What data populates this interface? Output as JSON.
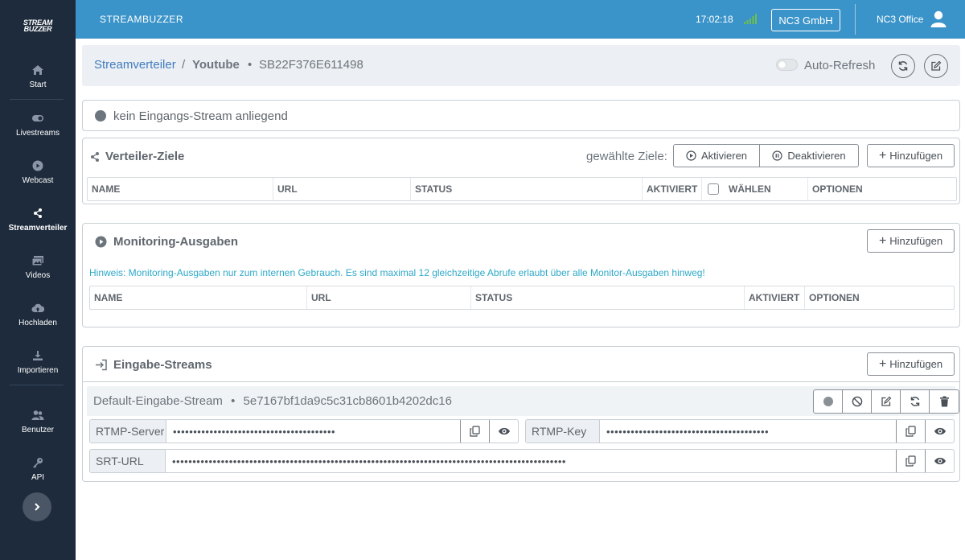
{
  "colors": {
    "sidebar_bg": "#1e2b3c",
    "topbar_bg": "#3b94c9",
    "link": "#3f7cbf",
    "hint": "#2ea9c7",
    "signal": "#6cc04a"
  },
  "sidebar": {
    "logo_line1": "STREAM",
    "logo_line2": "BUZZER",
    "items": [
      {
        "label": "Start",
        "icon": "home-icon"
      },
      {
        "label": "Livestreams",
        "icon": "toggle-icon"
      },
      {
        "label": "Webcast",
        "icon": "play-circle-icon"
      },
      {
        "label": "Streamverteiler",
        "icon": "share-icon",
        "active": true
      },
      {
        "label": "Videos",
        "icon": "images-icon"
      },
      {
        "label": "Hochladen",
        "icon": "cloud-upload-icon"
      },
      {
        "label": "Importieren",
        "icon": "download-icon"
      },
      {
        "label": "Benutzer",
        "icon": "users-icon"
      },
      {
        "label": "API",
        "icon": "key-icon"
      }
    ]
  },
  "topbar": {
    "brand": "STREAMBUZZER",
    "time": "17:02:18",
    "company": "NC3 GmbH",
    "user": "NC3 Office"
  },
  "breadcrumb": {
    "parent": "Streamverteiler",
    "separator": "/",
    "current": "Youtube",
    "dot": "•",
    "id": "SB22F376E611498",
    "auto_refresh_label": "Auto-Refresh",
    "auto_refresh_on": false
  },
  "status": {
    "text": "kein Eingangs-Stream anliegend"
  },
  "verteiler": {
    "title": "Verteiler-Ziele",
    "selected_label": "gewählte Ziele:",
    "activate": "Aktivieren",
    "deactivate": "Deaktivieren",
    "add": "Hinzufügen",
    "columns": [
      "NAME",
      "URL",
      "STATUS",
      "AKTIVIERT",
      "WÄHLEN",
      "OPTIONEN"
    ]
  },
  "monitoring": {
    "title": "Monitoring-Ausgaben",
    "add": "Hinzufügen",
    "hint": "Hinweis: Monitoring-Ausgaben nur zum internen Gebrauch. Es sind maximal 12 gleichzeitige Abrufe erlaubt über alle Monitor-Ausgaben hinweg!",
    "columns": [
      "NAME",
      "URL",
      "STATUS",
      "AKTIVIERT",
      "OPTIONEN"
    ]
  },
  "eingabe": {
    "title": "Eingabe-Streams",
    "add": "Hinzufügen",
    "stream_name": "Default-Eingabe-Stream",
    "stream_dot": "•",
    "stream_id": "5e7167bf1da9c5c31cb8601b4202dc16",
    "rtmp_server_label": "RTMP-Server",
    "rtmp_server_value": "••••••••••••••••••••••••••••••••••••••••",
    "rtmp_key_label": "RTMP-Key",
    "rtmp_key_value": "••••••••••••••••••••••••••••••••••••••••",
    "srt_label": "SRT-URL",
    "srt_value": "•••••••••••••••••••••••••••••••••••••••••••••••••••••••••••••••••••••••••••••••••••••••••••••••••"
  }
}
